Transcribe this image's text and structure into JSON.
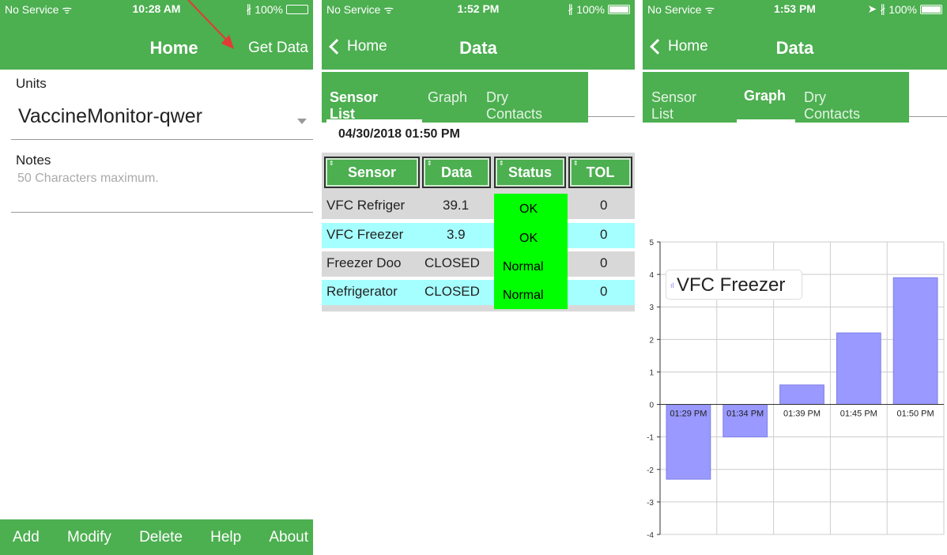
{
  "panels": {
    "home": {
      "status": {
        "carrier": "No Service",
        "time": "10:28 AM",
        "battery": "100%"
      },
      "title": "Home",
      "get_data": "Get Data",
      "units_label": "Units",
      "units_value": "VaccineMonitor-qwer",
      "notes_label": "Notes",
      "notes_placeholder": "50 Characters maximum.",
      "footer": [
        "Add",
        "Modify",
        "Delete",
        "Help",
        "About"
      ]
    },
    "data_list": {
      "status": {
        "carrier": "No Service",
        "time": "1:52 PM",
        "battery": "100%"
      },
      "back": "Home",
      "title": "Data",
      "tabs": [
        "Sensor List",
        "Graph",
        "Dry Contacts"
      ],
      "active_tab": 0,
      "date": "04/30/2018 01:50 PM",
      "columns": [
        "Sensor",
        "Data",
        "Status",
        "TOL"
      ],
      "rows": [
        [
          "VFC Refriger",
          "39.1",
          "OK",
          "0"
        ],
        [
          "VFC Freezer",
          "3.9",
          "OK",
          "0"
        ],
        [
          "Freezer  Doo",
          "CLOSED",
          "Normal",
          "0"
        ],
        [
          "Refrigerator",
          "CLOSED",
          "Normal",
          "0"
        ]
      ]
    },
    "data_graph": {
      "status": {
        "carrier": "No Service",
        "time": "1:53 PM",
        "battery": "100%"
      },
      "back": "Home",
      "title": "Data",
      "tabs": [
        "Sensor List",
        "Graph",
        "Dry Contacts"
      ],
      "active_tab": 1
    }
  },
  "colors": {
    "green": "#4caf50",
    "status_green": "#00ff00",
    "row_gray": "#d8d8d8",
    "row_cyan": "#a6ffff",
    "bar": "#9999ff",
    "arrow": "#e53935"
  },
  "icons": [
    "wifi-icon",
    "bluetooth-icon",
    "battery-icon",
    "location-icon",
    "chevron-left-icon",
    "dropdown-arrow-icon",
    "red-arrow-annotation"
  ],
  "chart_data": {
    "type": "bar",
    "categories": [
      "01:29 PM",
      "01:34 PM",
      "01:39 PM",
      "01:45 PM",
      "01:50 PM"
    ],
    "series": [
      {
        "name": "VFC Freezer",
        "values": [
          -2.3,
          -1.0,
          0.6,
          2.2,
          3.9
        ]
      }
    ],
    "ylim": [
      -4,
      5
    ],
    "yticks": [
      -4,
      -3,
      -2,
      -1,
      0,
      1,
      2,
      3,
      4,
      5
    ],
    "grid": true,
    "legend": "top-left"
  }
}
